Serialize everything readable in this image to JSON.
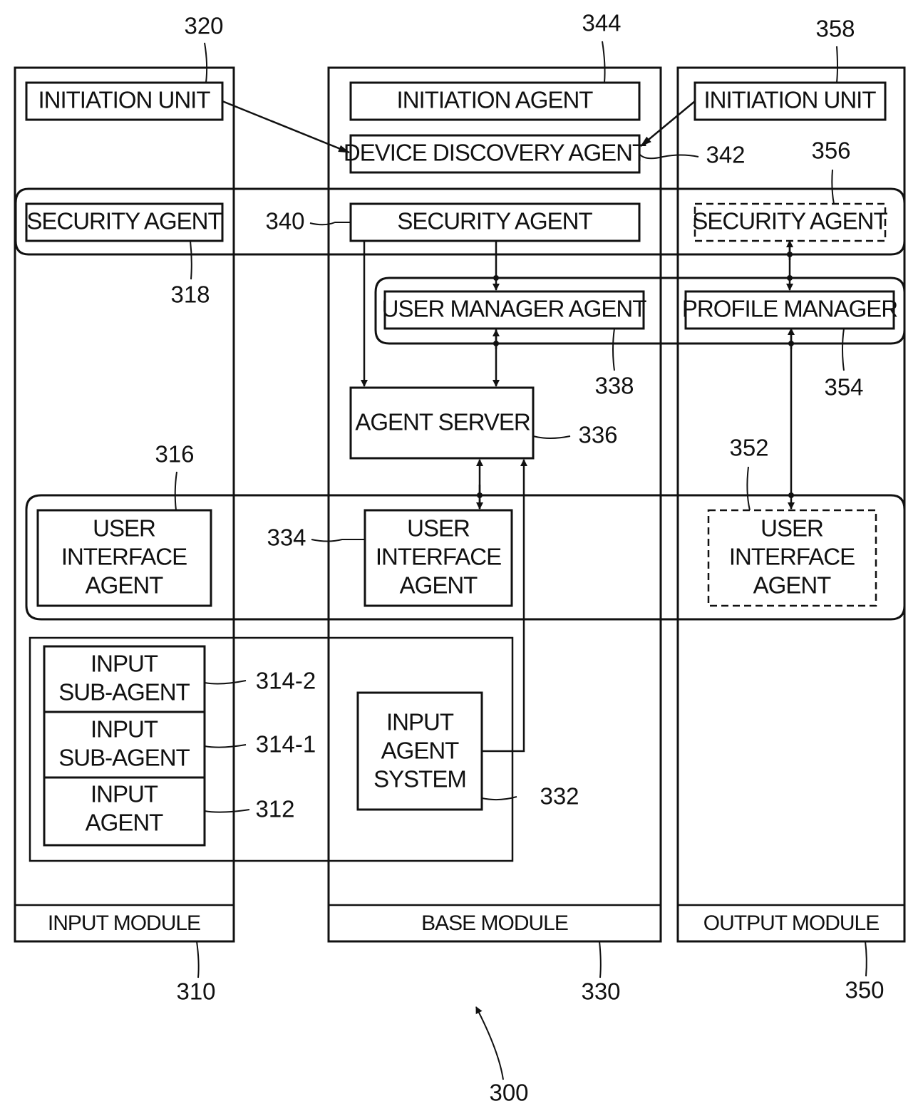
{
  "figure": {
    "ref": "300",
    "modules": [
      {
        "id": "input",
        "label": "INPUT MODULE",
        "ref": "310"
      },
      {
        "id": "base",
        "label": "BASE MODULE",
        "ref": "330"
      },
      {
        "id": "output",
        "label": "OUTPUT MODULE",
        "ref": "350"
      }
    ],
    "input_module": {
      "initiation_unit": {
        "label": "INITIATION UNIT",
        "ref": "320"
      },
      "security_agent": {
        "label": "SECURITY AGENT",
        "ref": "318"
      },
      "user_interface_agent": {
        "lines": [
          "USER",
          "INTERFACE",
          "AGENT"
        ],
        "ref": "316"
      },
      "input_sub_agent_2": {
        "lines": [
          "INPUT",
          "SUB-AGENT"
        ],
        "ref": "314-2"
      },
      "input_sub_agent_1": {
        "lines": [
          "INPUT",
          "SUB-AGENT"
        ],
        "ref": "314-1"
      },
      "input_agent": {
        "lines": [
          "INPUT",
          "AGENT"
        ],
        "ref": "312"
      }
    },
    "base_module": {
      "initiation_agent": {
        "label": "INITIATION AGENT",
        "ref": "344"
      },
      "device_discovery_agent": {
        "label": "DEVICE DISCOVERY AGENT",
        "ref": "342"
      },
      "security_agent": {
        "label": "SECURITY AGENT",
        "ref": "340"
      },
      "user_manager_agent": {
        "label": "USER MANAGER AGENT",
        "ref": "338"
      },
      "agent_server": {
        "label": "AGENT SERVER",
        "ref": "336"
      },
      "user_interface_agent": {
        "lines": [
          "USER",
          "INTERFACE",
          "AGENT"
        ],
        "ref": "334"
      },
      "input_agent_system": {
        "lines": [
          "INPUT",
          "AGENT",
          "SYSTEM"
        ],
        "ref": "332"
      }
    },
    "output_module": {
      "initiation_unit": {
        "label": "INITIATION UNIT",
        "ref": "358"
      },
      "security_agent": {
        "label": "SECURITY AGENT",
        "ref": "356",
        "style": "dashed"
      },
      "profile_manager": {
        "label": "PROFILE MANAGER",
        "ref": "354"
      },
      "user_interface_agent": {
        "lines": [
          "USER",
          "INTERFACE",
          "AGENT"
        ],
        "ref": "352",
        "style": "dashed"
      }
    }
  }
}
